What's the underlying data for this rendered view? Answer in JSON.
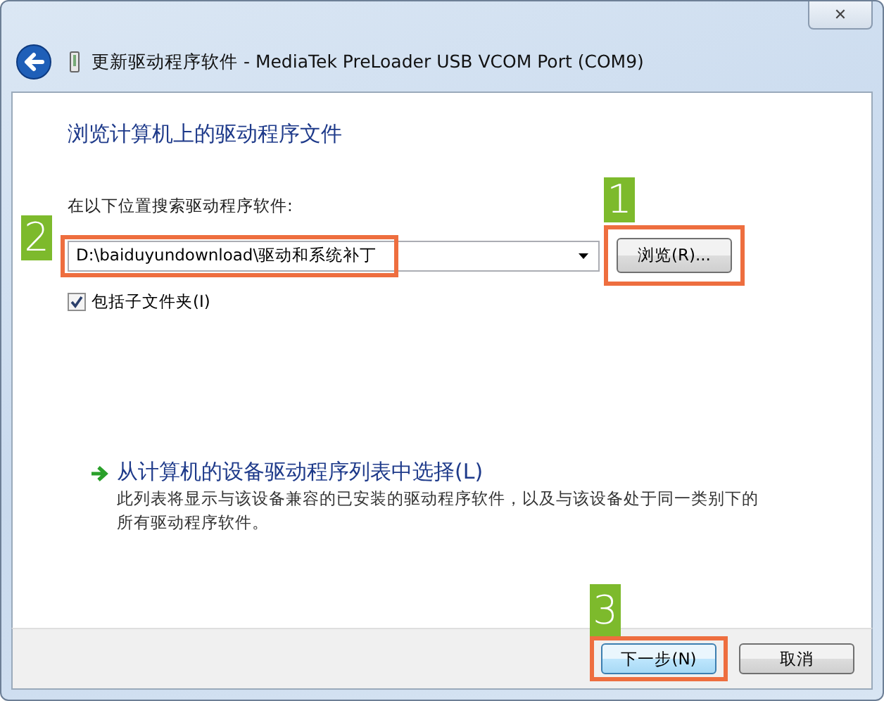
{
  "window": {
    "title": "更新驱动程序软件 - MediaTek PreLoader USB VCOM Port (COM9)",
    "close_label": "✕"
  },
  "heading": "浏览计算机上的驱动程序文件",
  "search": {
    "label": "在以下位置搜索驱动程序软件:",
    "value": "D:\\baiduyundownload\\驱动和系统补丁",
    "highlighted": true,
    "callout": "2"
  },
  "browse_button": {
    "label": "浏览(R)...",
    "highlighted": true,
    "callout": "1"
  },
  "include_subfolders": {
    "label": "包括子文件夹(I)",
    "checked": true
  },
  "pick_link": {
    "label": "从计算机的设备驱动程序列表中选择(L)",
    "description": "此列表将显示与该设备兼容的已安装的驱动程序软件，以及与该设备处于同一类别下的所有驱动程序软件。"
  },
  "buttons": [
    {
      "label": "下一步(N)",
      "default": true,
      "highlighted": true,
      "callout": "3"
    },
    {
      "label": "取消",
      "default": false,
      "highlighted": false
    }
  ]
}
